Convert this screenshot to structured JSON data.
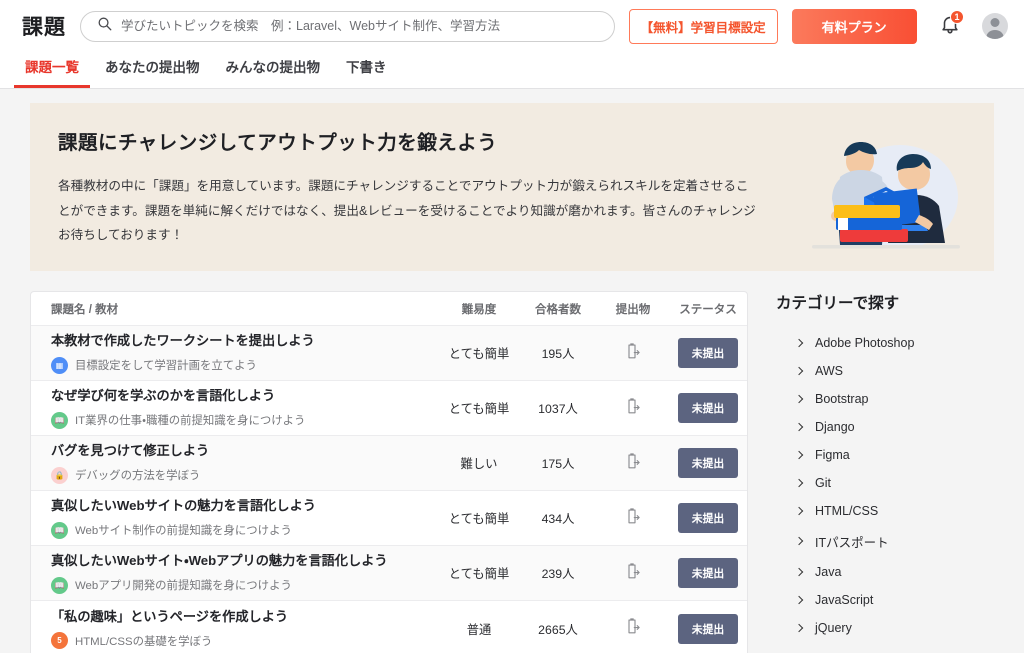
{
  "header": {
    "brand": "課題",
    "search": {
      "icon": "search-icon",
      "placeholder": "学びたいトピックを検索　例：Laravel、Webサイト制作、学習方法",
      "value": ""
    },
    "goal_button": "【無料】学習目標設定",
    "plan_button": "有料プラン",
    "notification": {
      "icon": "bell-icon",
      "count": "1"
    },
    "avatar": "user-avatar"
  },
  "tabs": [
    {
      "label": "課題一覧",
      "active": true
    },
    {
      "label": "あなたの提出物",
      "active": false
    },
    {
      "label": "みんなの提出物",
      "active": false
    },
    {
      "label": "下書き",
      "active": false
    }
  ],
  "hero": {
    "title": "課題にチャレンジしてアウトプット力を鍛えよう",
    "body": "各種教材の中に「課題」を用意しています。課題にチャレンジすることでアウトプット力が鍛えられスキルを定着させることができます。課題を単純に解くだけではなく、提出&レビューを受けることでより知識が磨かれます。皆さんのチャレンジお待ちしております！",
    "illustration": "two-people-reading-books-illustration",
    "background_color": "#f2ebe1"
  },
  "table": {
    "columns": [
      "課題名 / 教材",
      "難易度",
      "合格者数",
      "提出物",
      "ステータス"
    ],
    "rows": [
      {
        "title": "本教材で作成したワークシートを提出しよう",
        "material": "目標設定をして学習計画を立てよう",
        "material_icon": "blue-presentation-icon",
        "difficulty": "とても簡単",
        "passers": "195人",
        "submission_icon": "clipboard-export-icon",
        "status": "未提出"
      },
      {
        "title": "なぜ学び何を学ぶのかを言語化しよう",
        "material": "IT業界の仕事・職種の前提知識を身につけよう",
        "material_icon": "green-book-icon",
        "difficulty": "とても簡単",
        "passers": "1037人",
        "submission_icon": "clipboard-export-icon",
        "status": "未提出"
      },
      {
        "title": "バグを見つけて修正しよう",
        "material": "デバッグの方法を学ぼう",
        "material_icon": "pink-lock-icon",
        "difficulty": "難しい",
        "passers": "175人",
        "submission_icon": "clipboard-export-icon",
        "status": "未提出"
      },
      {
        "title": "真似したいWebサイトの魅力を言語化しよう",
        "material": "Webサイト制作の前提知識を身につけよう",
        "material_icon": "green-book-icon",
        "difficulty": "とても簡単",
        "passers": "434人",
        "submission_icon": "clipboard-export-icon",
        "status": "未提出"
      },
      {
        "title": "真似したいWebサイト・Webアプリの魅力を言語化しよう",
        "material": "Webアプリ開発の前提知識を身につけよう",
        "material_icon": "green-book-icon",
        "difficulty": "とても簡単",
        "passers": "239人",
        "submission_icon": "clipboard-export-icon",
        "status": "未提出"
      },
      {
        "title": "「私の趣味」というページを作成しよう",
        "material": "HTML/CSSの基礎を学ぼう",
        "material_icon": "html5-icon",
        "difficulty": "普通",
        "passers": "2665人",
        "submission_icon": "clipboard-export-icon",
        "status": "未提出"
      }
    ]
  },
  "sidebar": {
    "title": "カテゴリーで探す",
    "categories": [
      {
        "label": "Adobe Photoshop"
      },
      {
        "label": "AWS"
      },
      {
        "label": "Bootstrap"
      },
      {
        "label": "Django"
      },
      {
        "label": "Figma"
      },
      {
        "label": "Git"
      },
      {
        "label": "HTML/CSS"
      },
      {
        "label": "ITパスポート"
      },
      {
        "label": "Java"
      },
      {
        "label": "JavaScript"
      },
      {
        "label": "jQuery"
      }
    ]
  },
  "colors": {
    "accent_red": "#e8372c",
    "plan_orange": "#f94f34",
    "badge_slate": "#5c6480",
    "hero_beige": "#f2ebe1"
  }
}
